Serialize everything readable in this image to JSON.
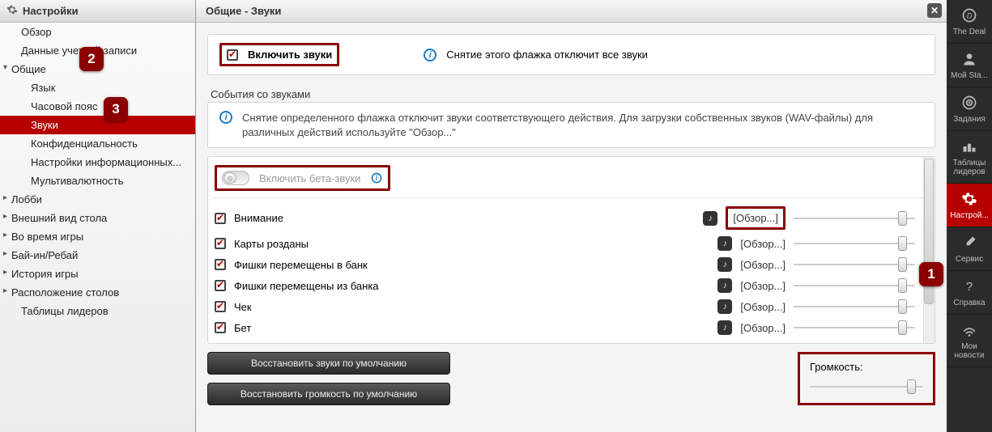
{
  "sidebar": {
    "title": "Настройки",
    "items": [
      {
        "label": "Обзор",
        "type": "item"
      },
      {
        "label": "Данные учетной записи",
        "type": "item"
      },
      {
        "label": "Общие",
        "type": "group",
        "open": true,
        "children": [
          {
            "label": "Язык"
          },
          {
            "label": "Часовой пояс"
          },
          {
            "label": "Звуки",
            "active": true
          },
          {
            "label": "Конфиденциальность"
          },
          {
            "label": "Настройки информационных..."
          },
          {
            "label": "Мультивалютность"
          }
        ]
      },
      {
        "label": "Лобби",
        "type": "group"
      },
      {
        "label": "Внешний вид стола",
        "type": "group"
      },
      {
        "label": "Во время игры",
        "type": "group"
      },
      {
        "label": "Бай-ин/Ребай",
        "type": "group"
      },
      {
        "label": "История игры",
        "type": "group"
      },
      {
        "label": "Расположение столов",
        "type": "group"
      },
      {
        "label": "Таблицы лидеров",
        "type": "item"
      }
    ]
  },
  "main": {
    "title": "Общие - Звуки",
    "enable_label": "Включить звуки",
    "enable_hint": "Снятие этого флажка отключит все звуки",
    "events_title": "События со звуками",
    "events_hint": "Снятие определенного флажка отключит звуки соответствующего действия. Для загрузки собственных звуков (WAV-файлы) для различных действий используйте \"Обзор...\"",
    "beta_label": "Включить бета-звуки",
    "browse_label": "[Обзор...]",
    "sounds": [
      {
        "name": "Внимание",
        "checked": true,
        "vol": 0.92,
        "hl_browse": true
      },
      {
        "name": "Карты розданы",
        "checked": true,
        "vol": 0.92
      },
      {
        "name": "Фишки перемещены в банк",
        "checked": true,
        "vol": 0.92
      },
      {
        "name": "Фишки перемещены из банка",
        "checked": true,
        "vol": 0.92
      },
      {
        "name": "Чек",
        "checked": true,
        "vol": 0.92
      },
      {
        "name": "Бет",
        "checked": true,
        "vol": 0.92
      }
    ],
    "restore_sounds": "Восстановить звуки по умолчанию",
    "restore_volume": "Восстановить громкость по умолчанию",
    "volume_label": "Громкость:",
    "master_vol": 0.92
  },
  "rail": [
    {
      "icon": "deal",
      "label": "The Deal"
    },
    {
      "icon": "user",
      "label": "Мой Sta..."
    },
    {
      "icon": "target",
      "label": "Задания"
    },
    {
      "icon": "podium",
      "label": "Таблицы лидеров"
    },
    {
      "icon": "gear",
      "label": "Настрой...",
      "active": true
    },
    {
      "icon": "tools",
      "label": "Сервис"
    },
    {
      "icon": "help",
      "label": "Справка"
    },
    {
      "icon": "news",
      "label": "Мои новости"
    }
  ],
  "callouts": {
    "c1": "1",
    "c2": "2",
    "c3": "3"
  }
}
